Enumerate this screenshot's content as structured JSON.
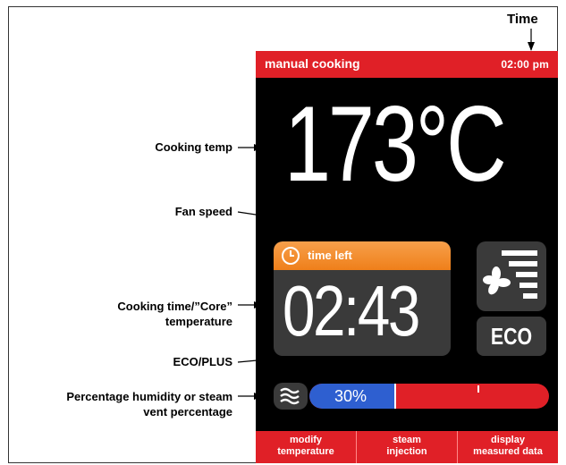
{
  "header": {
    "title": "manual cooking",
    "time": "02:00 pm"
  },
  "cooking": {
    "temperature": "173°C"
  },
  "timer": {
    "label": "time left",
    "value": "02:43"
  },
  "eco": {
    "label": "ECO"
  },
  "humidity": {
    "percent": 30,
    "label": "30%"
  },
  "buttons": [
    {
      "line1": "modify",
      "line2": "temperature"
    },
    {
      "line1": "steam",
      "line2": "injection"
    },
    {
      "line1": "display",
      "line2": "measured data"
    }
  ],
  "annotations": {
    "time": "Time",
    "cooking_temp": "Cooking temp",
    "fan_speed": "Fan speed",
    "cooking_time_line1": "Cooking time/”Core”",
    "cooking_time_line2": "temperature",
    "eco_plus": "ECO/PLUS",
    "humidity_line1": "Percentage humidity or steam",
    "humidity_line2": "vent percentage"
  },
  "colors": {
    "accent_red": "#e02027",
    "timer_orange": "#ef7f1a",
    "humidity_blue": "#2e5fd0",
    "panel_grey": "#3a3a3a"
  },
  "icons": {
    "timer": "clock-icon",
    "fan": "fan-icon",
    "humidity": "steam-waves-icon"
  }
}
